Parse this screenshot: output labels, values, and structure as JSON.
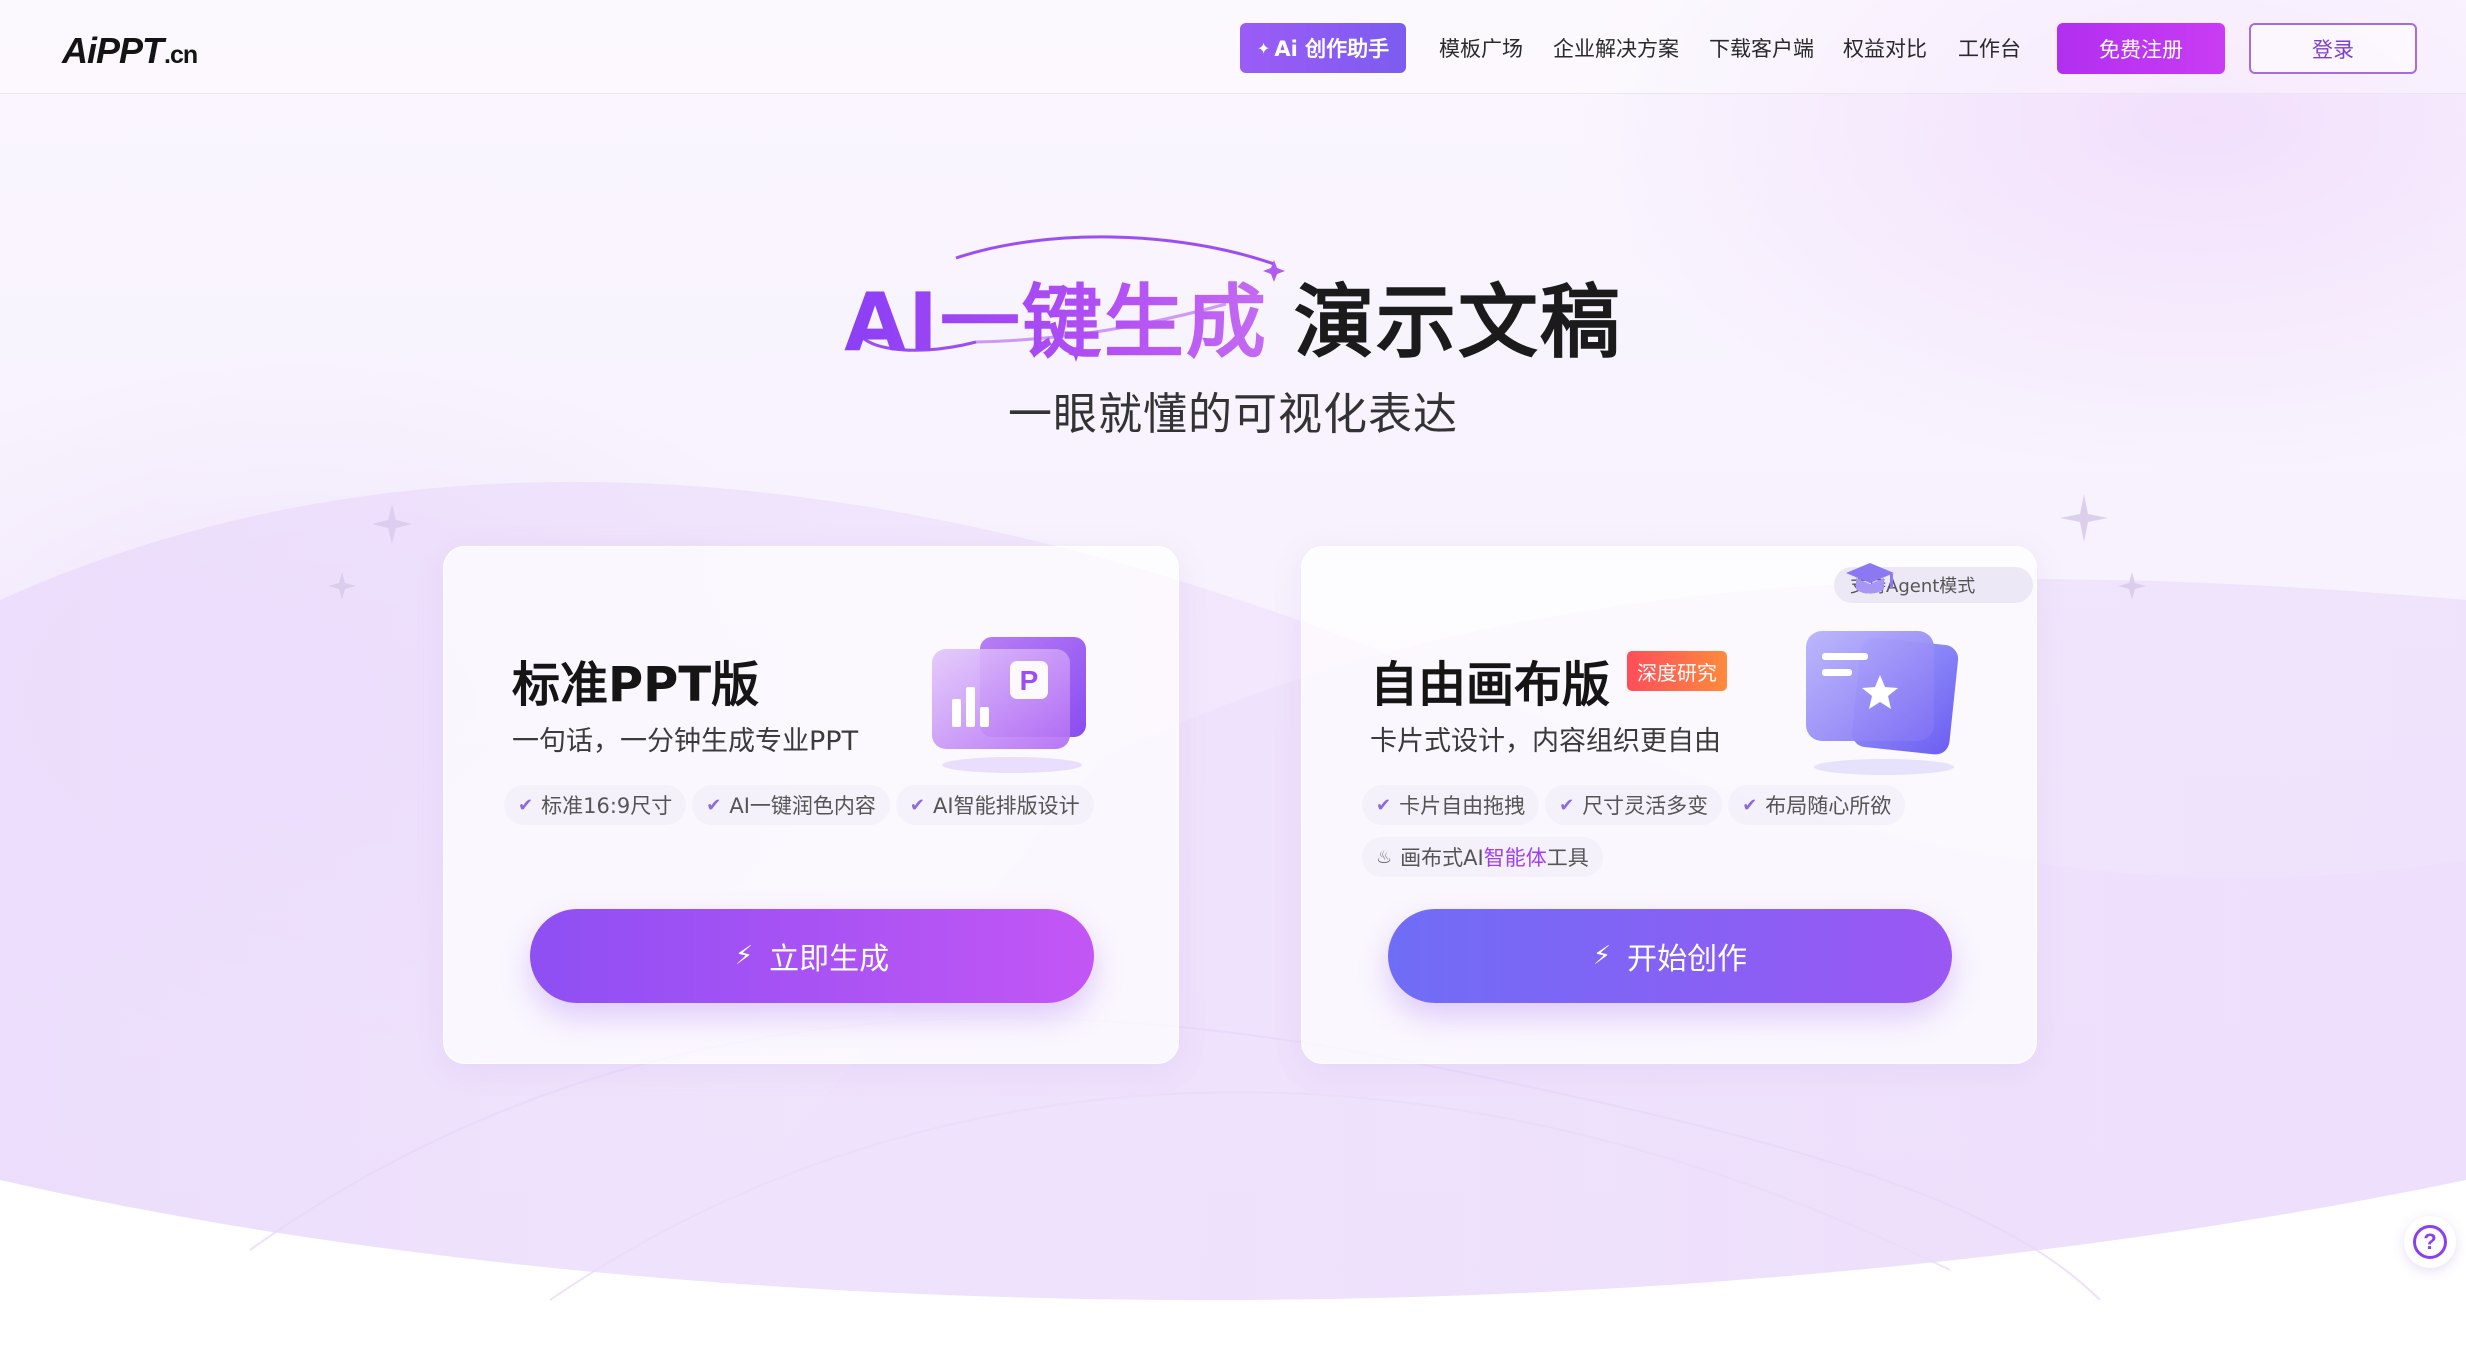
{
  "header": {
    "logo_main": "AiPPT",
    "logo_suffix": ".cn",
    "ai_button_label": "Ai 创作助手",
    "nav": [
      "模板广场",
      "企业解决方案",
      "下载客户端",
      "权益对比",
      "工作台"
    ],
    "register_label": "免费注册",
    "login_label": "登录"
  },
  "hero": {
    "title_highlight": "AI一键生成",
    "title_rest": "演示文稿",
    "subtitle": "一眼就懂的可视化表达"
  },
  "cards": [
    {
      "title": "标准PPT版",
      "description": "一句话，一分钟生成专业PPT",
      "tags": [
        "标准16:9尺寸",
        "AI一键润色内容",
        "AI智能排版设计"
      ],
      "button_label": "立即生成"
    },
    {
      "title": "自由画布版",
      "badge": "深度研究",
      "agent_pill": "支持Agent模式",
      "description": "卡片式设计，内容组织更自由",
      "tags": [
        "卡片自由拖拽",
        "尺寸灵活多变",
        "布局随心所欲"
      ],
      "tool_tag_prefix": "画布式AI",
      "tool_tag_highlight": "智能体",
      "tool_tag_suffix": "工具",
      "button_label": "开始创作"
    }
  ],
  "help_label": "?",
  "colors": {
    "brand_purple": "#8e4ff3",
    "brand_magenta": "#c93cf3",
    "badge_red": "#ff4d5a"
  }
}
